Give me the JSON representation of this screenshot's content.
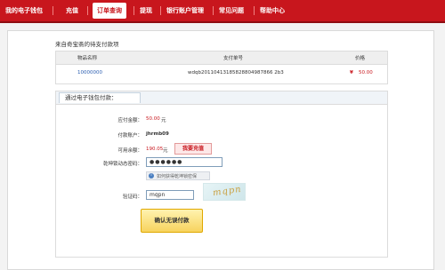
{
  "nav": {
    "items": [
      {
        "label": "我的电子钱包"
      },
      {
        "label": "充值"
      },
      {
        "label": "订单查询"
      },
      {
        "label": "提现"
      },
      {
        "label": "银行账户管理"
      },
      {
        "label": "常见问题"
      },
      {
        "label": "帮助中心"
      }
    ],
    "active_index": 2
  },
  "order": {
    "title": "来自奇宝斋的待支付款项",
    "columns": [
      "物品名称",
      "支付单号",
      "价格"
    ],
    "row": {
      "item_name": "10000000",
      "payment_no": "wdqb20110413185828804987866 2b3",
      "currency": "¥",
      "price": "50.00"
    }
  },
  "payment": {
    "tab_label": "通过电子钱包付款：",
    "amount_label": "应付金额：",
    "amount_value": "50.00",
    "amount_unit": "元",
    "account_label": "付款账户：",
    "account_value": "jhrmb09",
    "balance_label": "可用余额：",
    "balance_value": "190.05",
    "balance_unit": "元",
    "recharge_button": "我要充值",
    "password_label": "乾坤锁动态密码：",
    "password_value": "●●●●●●",
    "hint_text": "如何获得乾坤锁密保",
    "captcha_label": "验证码：",
    "captcha_value": "mqpn",
    "captcha_image_text": "mqpn",
    "confirm_button": "确认无误付款"
  },
  "colors": {
    "brand_red": "#c8161d",
    "button_yellow": "#f7d35e"
  }
}
